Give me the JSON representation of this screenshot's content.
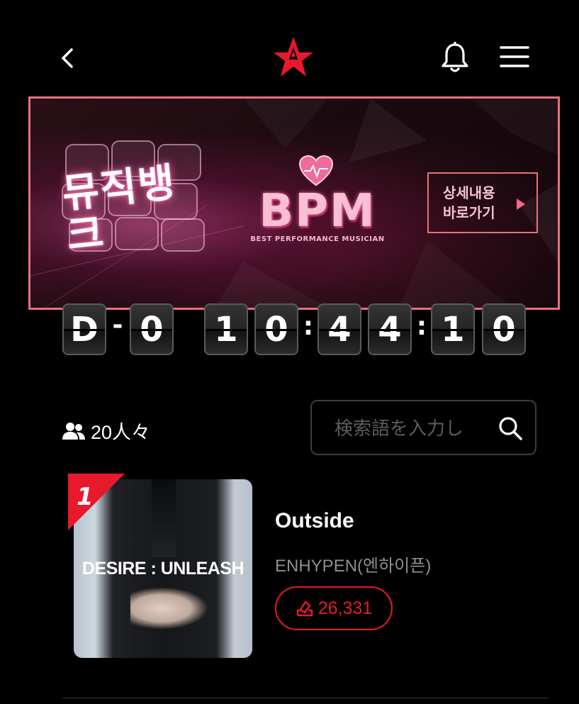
{
  "header": {
    "back_icon": "chevron-left-icon",
    "logo_icon": "star-a-logo",
    "bell_icon": "bell-icon",
    "menu_icon": "hamburger-menu-icon",
    "accent_color": "#e8192c"
  },
  "banner": {
    "cube_text": "뮤직뱅크",
    "bpm_title": "BPM",
    "bpm_subtitle": "BEST PERFORMANCE MUSICIAN",
    "detail_button": "상세내용\n바로가기",
    "border_color": "#e5727e"
  },
  "countdown": {
    "day_chars": [
      "D",
      "0"
    ],
    "day_separator": "-",
    "time_digits": [
      "1",
      "0",
      "4",
      "4",
      "1",
      "0"
    ],
    "time_separator": ":"
  },
  "participants": {
    "icon": "users-icon",
    "label": "20人々"
  },
  "search": {
    "placeholder": "検索語を入力し",
    "icon": "search-icon"
  },
  "ranking": [
    {
      "rank": "1",
      "cover_text": "DESIRE : UNLEASH",
      "title": "Outside",
      "artist": "ENHYPEN(엔하이픈)",
      "votes": "26,331",
      "vote_icon": "vote-icon"
    }
  ]
}
